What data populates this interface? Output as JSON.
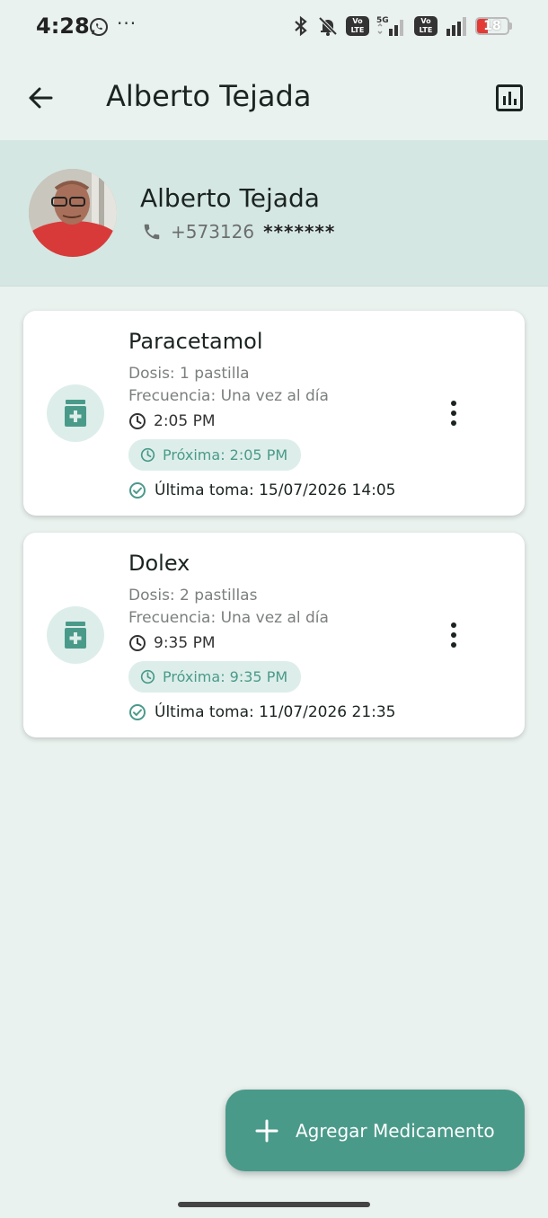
{
  "status_bar": {
    "time": "4:28",
    "overflow": "···",
    "network": "5G",
    "volte_label": "Vo LTE",
    "battery_level": "18",
    "icons": [
      "whatsapp-icon",
      "bluetooth-icon",
      "bell-off-icon",
      "volte-icon",
      "signal-icon",
      "battery-icon"
    ]
  },
  "app_bar": {
    "title": "Alberto Tejada",
    "back_icon": "arrow-left-icon",
    "action_icon": "bar-chart-icon"
  },
  "profile": {
    "name": "Alberto Tejada",
    "phone": "+573126",
    "phone_masked": "*******",
    "phone_icon": "phone-icon"
  },
  "medications": [
    {
      "name": "Paracetamol",
      "dose": "Dosis: 1 pastilla",
      "frequency": "Frecuencia: Una vez al día",
      "time": "2:05 PM",
      "next": "Próxima: 2:05 PM",
      "last_taken": "Última toma: 15/07/2026 14:05"
    },
    {
      "name": "Dolex",
      "dose": "Dosis: 2 pastillas",
      "frequency": "Frecuencia: Una vez al día",
      "time": "9:35 PM",
      "next": "Próxima: 9:35 PM",
      "last_taken": "Última toma: 11/07/2026 21:35"
    }
  ],
  "fab": {
    "label": "Agregar Medicamento",
    "icon": "plus-icon"
  },
  "colors": {
    "background": "#EAF2EF",
    "header_band": "#D5E7E3",
    "accent": "#4A9A8A",
    "chip_bg": "#DDEEEA",
    "battery_low": "#E53935"
  }
}
